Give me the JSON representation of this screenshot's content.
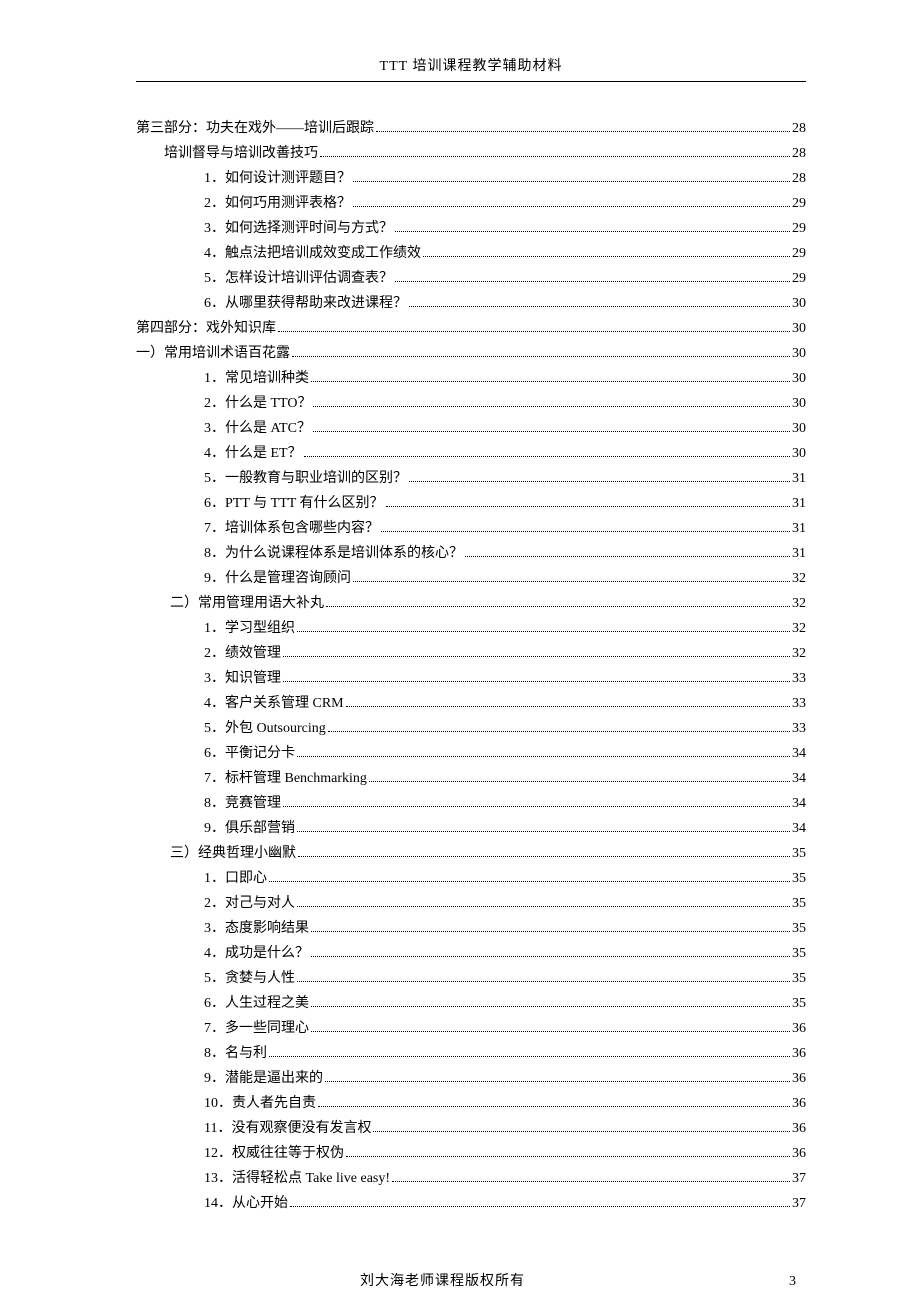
{
  "header": {
    "title": "TTT 培训课程教学辅助材料"
  },
  "toc": [
    {
      "indent": 0,
      "label": "第三部分：功夫在戏外——培训后跟踪",
      "page": "28"
    },
    {
      "indent": 1,
      "label": "培训督导与培训改善技巧",
      "page": "28"
    },
    {
      "indent": 2,
      "label": "1．如何设计测评题目？",
      "page": "28"
    },
    {
      "indent": 2,
      "label": "2．如何巧用测评表格？",
      "page": "29"
    },
    {
      "indent": 2,
      "label": "3．如何选择测评时间与方式？",
      "page": "29"
    },
    {
      "indent": 2,
      "label": "4．触点法把培训成效变成工作绩效",
      "page": "29"
    },
    {
      "indent": 2,
      "label": "5．怎样设计培训评估调查表？",
      "page": "29"
    },
    {
      "indent": 2,
      "label": "6．从哪里获得帮助来改进课程？",
      "page": "30"
    },
    {
      "indent": 0,
      "label": "第四部分：戏外知识库",
      "page": "30"
    },
    {
      "indent": 0,
      "label": "一）常用培训术语百花露",
      "page": "30"
    },
    {
      "indent": 2,
      "label": "1．常见培训种类",
      "page": "30"
    },
    {
      "indent": 2,
      "label": "2．什么是 TTO？",
      "page": "30"
    },
    {
      "indent": 2,
      "label": "3．什么是 ATC？",
      "page": "30"
    },
    {
      "indent": 2,
      "label": "4．什么是 ET？",
      "page": "30"
    },
    {
      "indent": 2,
      "label": "5．一般教育与职业培训的区别？",
      "page": "31"
    },
    {
      "indent": 2,
      "label": "6．PTT 与 TTT 有什么区别？",
      "page": "31"
    },
    {
      "indent": 2,
      "label": "7．培训体系包含哪些内容？",
      "page": "31"
    },
    {
      "indent": 2,
      "label": "8．为什么说课程体系是培训体系的核心？",
      "page": "31"
    },
    {
      "indent": 2,
      "label": "9．什么是管理咨询顾问",
      "page": "32"
    },
    {
      "indent": 3,
      "label": "二）常用管理用语大补丸",
      "page": "32"
    },
    {
      "indent": 2,
      "label": "1．学习型组织",
      "page": "32"
    },
    {
      "indent": 2,
      "label": "2．绩效管理",
      "page": "32"
    },
    {
      "indent": 2,
      "label": "3．知识管理",
      "page": "33"
    },
    {
      "indent": 2,
      "label": "4．客户关系管理 CRM",
      "page": "33"
    },
    {
      "indent": 2,
      "label": "5．外包 Outsourcing",
      "page": "33"
    },
    {
      "indent": 2,
      "label": "6．平衡记分卡",
      "page": "34"
    },
    {
      "indent": 2,
      "label": "7．标杆管理 Benchmarking",
      "page": "34"
    },
    {
      "indent": 2,
      "label": "8．竞赛管理",
      "page": "34"
    },
    {
      "indent": 2,
      "label": "9．俱乐部营销",
      "page": "34"
    },
    {
      "indent": 3,
      "label": "三）经典哲理小幽默",
      "page": "35"
    },
    {
      "indent": 2,
      "label": "1．口即心",
      "page": "35"
    },
    {
      "indent": 2,
      "label": "2．对己与对人",
      "page": "35"
    },
    {
      "indent": 2,
      "label": "3．态度影响结果",
      "page": "35"
    },
    {
      "indent": 2,
      "label": "4．成功是什么？",
      "page": "35"
    },
    {
      "indent": 2,
      "label": "5．贪婪与人性",
      "page": "35"
    },
    {
      "indent": 2,
      "label": "6．人生过程之美",
      "page": "35"
    },
    {
      "indent": 2,
      "label": "7．多一些同理心",
      "page": "36"
    },
    {
      "indent": 2,
      "label": "8．名与利",
      "page": "36"
    },
    {
      "indent": 2,
      "label": "9．潜能是逼出来的",
      "page": "36"
    },
    {
      "indent": 2,
      "label": "10．责人者先自责",
      "page": "36"
    },
    {
      "indent": 2,
      "label": "11．没有观察便没有发言权",
      "page": "36"
    },
    {
      "indent": 2,
      "label": "12．权威往往等于权伪",
      "page": "36"
    },
    {
      "indent": 2,
      "label": "13．活得轻松点 Take live easy!",
      "page": "37"
    },
    {
      "indent": 2,
      "label": "14．从心开始",
      "page": "37"
    }
  ],
  "footer": {
    "copyright": "刘大海老师课程版权所有",
    "page_number": "3"
  }
}
